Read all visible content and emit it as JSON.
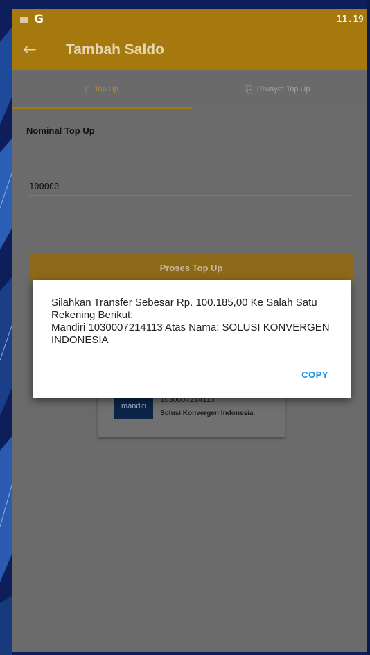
{
  "status_bar": {
    "time": "11.19",
    "icons": [
      "mail-icon",
      "google-icon"
    ],
    "g_glyph": "G"
  },
  "app_bar": {
    "title": "Tambah Saldo",
    "back_icon": "arrow-left-icon"
  },
  "tabs": [
    {
      "label": "Top Up",
      "icon": "topup-icon",
      "active": true
    },
    {
      "label": "Riwayat Top Up",
      "icon": "history-icon",
      "active": false
    }
  ],
  "form": {
    "label": "Nominal Top Up",
    "value": "100000",
    "button_label": "Proses Top Up"
  },
  "bank_card": {
    "logo_text": "mandiri",
    "account_number": "1030007214113",
    "account_name": "Solusi Konvergen Indonesia"
  },
  "dialog": {
    "message": "Silahkan Transfer Sebesar Rp. 100.185,00 Ke Salah Satu Rekening Berikut:\nMandiri 1030007214113 Atas Nama: SOLUSI KONVERGEN INDONESIA",
    "copy_label": "COPY"
  },
  "colors": {
    "accent": "#a6790f",
    "dialog_action": "#1a8ee0",
    "wallpaper": "#0d1e5a"
  }
}
